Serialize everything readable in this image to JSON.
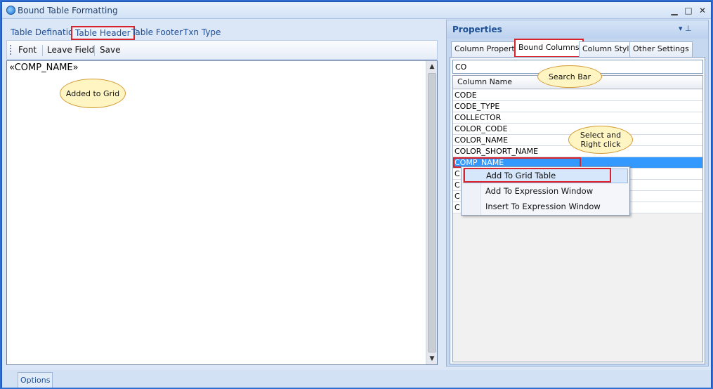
{
  "window": {
    "title": "Bound Table Formatting",
    "minimize": "▁",
    "maximize": "□",
    "close": "✕"
  },
  "left": {
    "tabs": [
      "Table Defination",
      "Table Header",
      "Table Footer",
      "Txn Type"
    ],
    "selected_tab": "Table Header",
    "toolbar": {
      "font": "Font",
      "leave_field": "Leave Field",
      "save": "Save"
    },
    "editor_text": "«COMP_NAME»",
    "callout": "Added to Grid"
  },
  "properties": {
    "title": "Properties",
    "pin_glyph": "▾  ⊥",
    "tabs": [
      "Column Property",
      "Bound Columns",
      "Column Style",
      "Other Settings"
    ],
    "selected_tab": "Bound Columns",
    "search_value": "CO",
    "search_callout": "Search Bar",
    "grid_header": "Column Name",
    "rows": [
      "CODE",
      "CODE_TYPE",
      "COLLECTOR",
      "COLOR_CODE",
      "COLOR_NAME",
      "COLOR_SHORT_NAME",
      "COMP_NAME",
      "C",
      "C",
      "C",
      "C"
    ],
    "selected_row": "COMP_NAME",
    "select_callout": "Select and Right click"
  },
  "context_menu": {
    "items": [
      "Add To Grid Table",
      "Add To Expression Window",
      "Insert To Expression Window"
    ],
    "highlighted": "Add To Grid Table"
  },
  "status": {
    "options": "Options"
  }
}
